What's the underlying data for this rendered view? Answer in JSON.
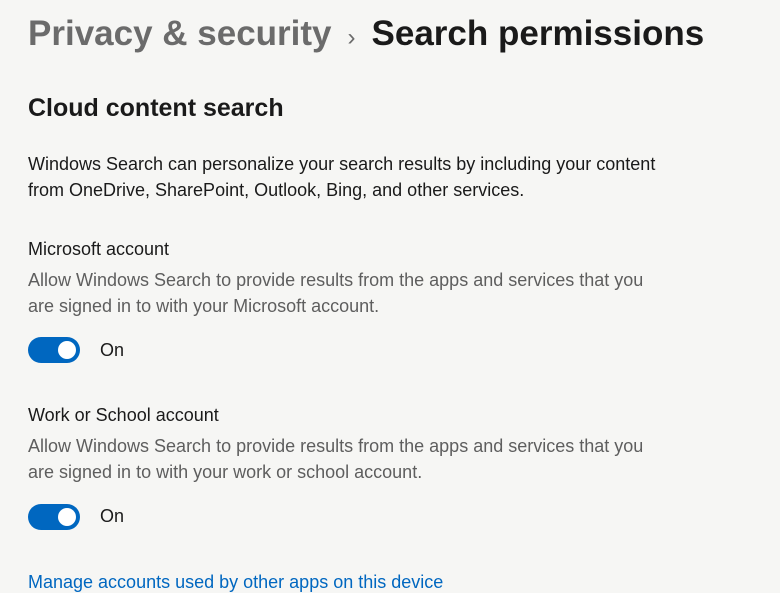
{
  "breadcrumb": {
    "parent": "Privacy & security",
    "separator": "›",
    "current": "Search permissions"
  },
  "section": {
    "title": "Cloud content search",
    "description": "Windows Search can personalize your search results by including your content from OneDrive, SharePoint, Outlook, Bing, and other services."
  },
  "settings": [
    {
      "label": "Microsoft account",
      "description": "Allow Windows Search to provide results from the apps and services that you are signed in to with your Microsoft account.",
      "state": "On",
      "on": true
    },
    {
      "label": "Work or School account",
      "description": "Allow Windows Search to provide results from the apps and services that you are signed in to with your work or school account.",
      "state": "On",
      "on": true
    }
  ],
  "link": {
    "manage_accounts": "Manage accounts used by other apps on this device"
  }
}
